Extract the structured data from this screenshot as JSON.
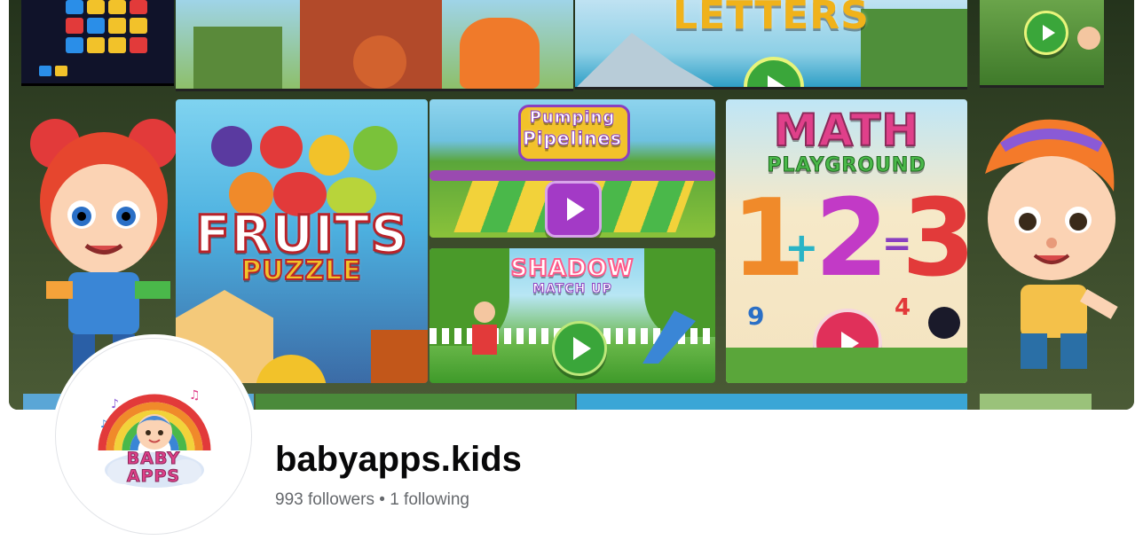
{
  "profile": {
    "name": "babyapps.kids",
    "followers_count": "993",
    "followers_label": "followers",
    "separator": "•",
    "following_count": "1",
    "following_label": "following"
  },
  "cover": {
    "tiles": [
      {
        "title_line1": "FRUITS",
        "title_line2": "PUZZLE",
        "color": "#e23a3a"
      },
      {
        "title_line1": "Pumping",
        "title_line2": "Pipelines",
        "color": "#8a3fc0"
      },
      {
        "title_line1": "SHADOW",
        "title_line2": "MATCH UP",
        "color": "#ff5a8a"
      },
      {
        "title_line1": "MATH",
        "title_line2": "PLAYGROUND",
        "math_1": "1",
        "math_plus": "+",
        "math_2": "2",
        "math_eq": "=",
        "math_3": "3",
        "math_9": "9",
        "math_4": "4",
        "color": "#e0408a"
      },
      {
        "title_line1": "LETTERS",
        "color": "#f0b21a"
      }
    ]
  },
  "avatar": {
    "logo_line1": "BABY",
    "logo_line2": "APPS"
  },
  "colors": {
    "name_text": "#080809",
    "meta_text": "#65686c"
  }
}
